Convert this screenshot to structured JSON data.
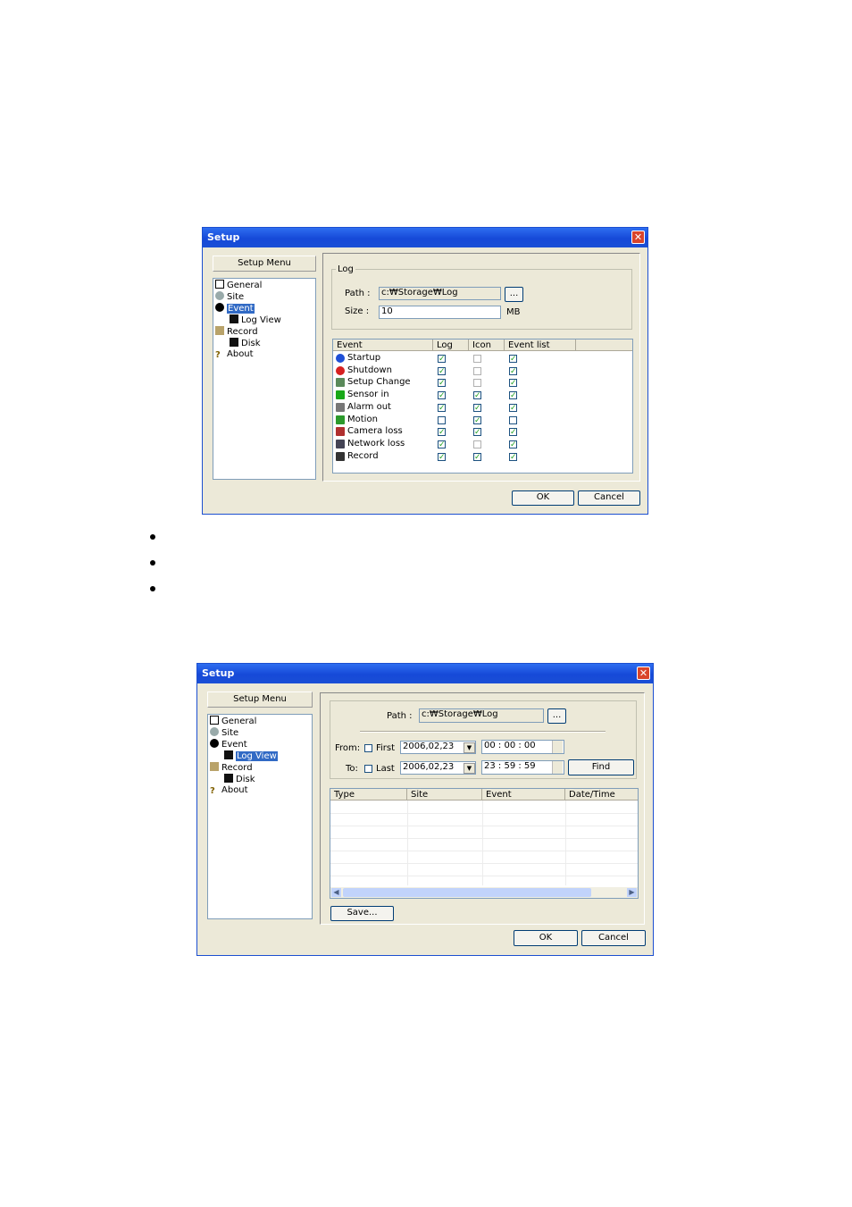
{
  "dialog1": {
    "title": "Setup",
    "menu_header": "Setup Menu",
    "tree": [
      {
        "label": "General",
        "icon": "general-icon"
      },
      {
        "label": "Site",
        "icon": "site-icon"
      },
      {
        "label": "Event",
        "icon": "event-icon",
        "selected": true
      },
      {
        "label": "Log View",
        "icon": "disk-icon"
      },
      {
        "label": "Record",
        "icon": "record-icon"
      },
      {
        "label": "Disk",
        "icon": "disk-icon"
      },
      {
        "label": "About",
        "icon": "question-icon"
      }
    ],
    "log_group": "Log",
    "path_label": "Path :",
    "path_value": "c:₩Storage₩Log",
    "browse_label": "...",
    "size_label": "Size :",
    "size_value": "10",
    "size_unit": "MB",
    "columns": [
      "Event",
      "Log",
      "Icon",
      "Event list"
    ],
    "events": [
      {
        "name": "Startup",
        "icon": "info-icon",
        "log": true,
        "icon_on": false,
        "list": true
      },
      {
        "name": "Shutdown",
        "icon": "stop-icon",
        "log": true,
        "icon_on": false,
        "list": true
      },
      {
        "name": "Setup Change",
        "icon": "setup-icon",
        "log": true,
        "icon_on": false,
        "list": true
      },
      {
        "name": "Sensor in",
        "icon": "sensor-icon",
        "log": true,
        "icon_on": true,
        "list": true
      },
      {
        "name": "Alarm out",
        "icon": "alarm-icon",
        "log": true,
        "icon_on": true,
        "list": true
      },
      {
        "name": "Motion",
        "icon": "motion-icon",
        "log": false,
        "icon_on": true,
        "list": false
      },
      {
        "name": "Camera loss",
        "icon": "camera-icon",
        "log": true,
        "icon_on": true,
        "list": true
      },
      {
        "name": "Network loss",
        "icon": "network-icon",
        "log": true,
        "icon_on": false,
        "list": true
      },
      {
        "name": "Record",
        "icon": "record-disk-icon",
        "log": true,
        "icon_on": true,
        "list": true
      }
    ],
    "ok_label": "OK",
    "cancel_label": "Cancel"
  },
  "dialog2": {
    "title": "Setup",
    "menu_header": "Setup Menu",
    "tree": [
      {
        "label": "General",
        "icon": "general-icon"
      },
      {
        "label": "Site",
        "icon": "site-icon"
      },
      {
        "label": "Event",
        "icon": "event-icon"
      },
      {
        "label": "Log View",
        "icon": "disk-icon",
        "selected": true
      },
      {
        "label": "Record",
        "icon": "record-icon"
      },
      {
        "label": "Disk",
        "icon": "disk-icon"
      },
      {
        "label": "About",
        "icon": "question-icon"
      }
    ],
    "path_label": "Path :",
    "path_value": "c:₩Storage₩Log",
    "browse_label": "...",
    "from_label": "From:",
    "first_label": "First",
    "from_date": "2006,02,23",
    "from_time": "00 : 00 : 00",
    "to_label": "To:",
    "last_label": "Last",
    "to_date": "2006,02,23",
    "to_time": "23 : 59 : 59",
    "find_label": "Find",
    "columns": [
      "Type",
      "Site",
      "Event",
      "Date/Time"
    ],
    "save_label": "Save...",
    "ok_label": "OK",
    "cancel_label": "Cancel"
  }
}
